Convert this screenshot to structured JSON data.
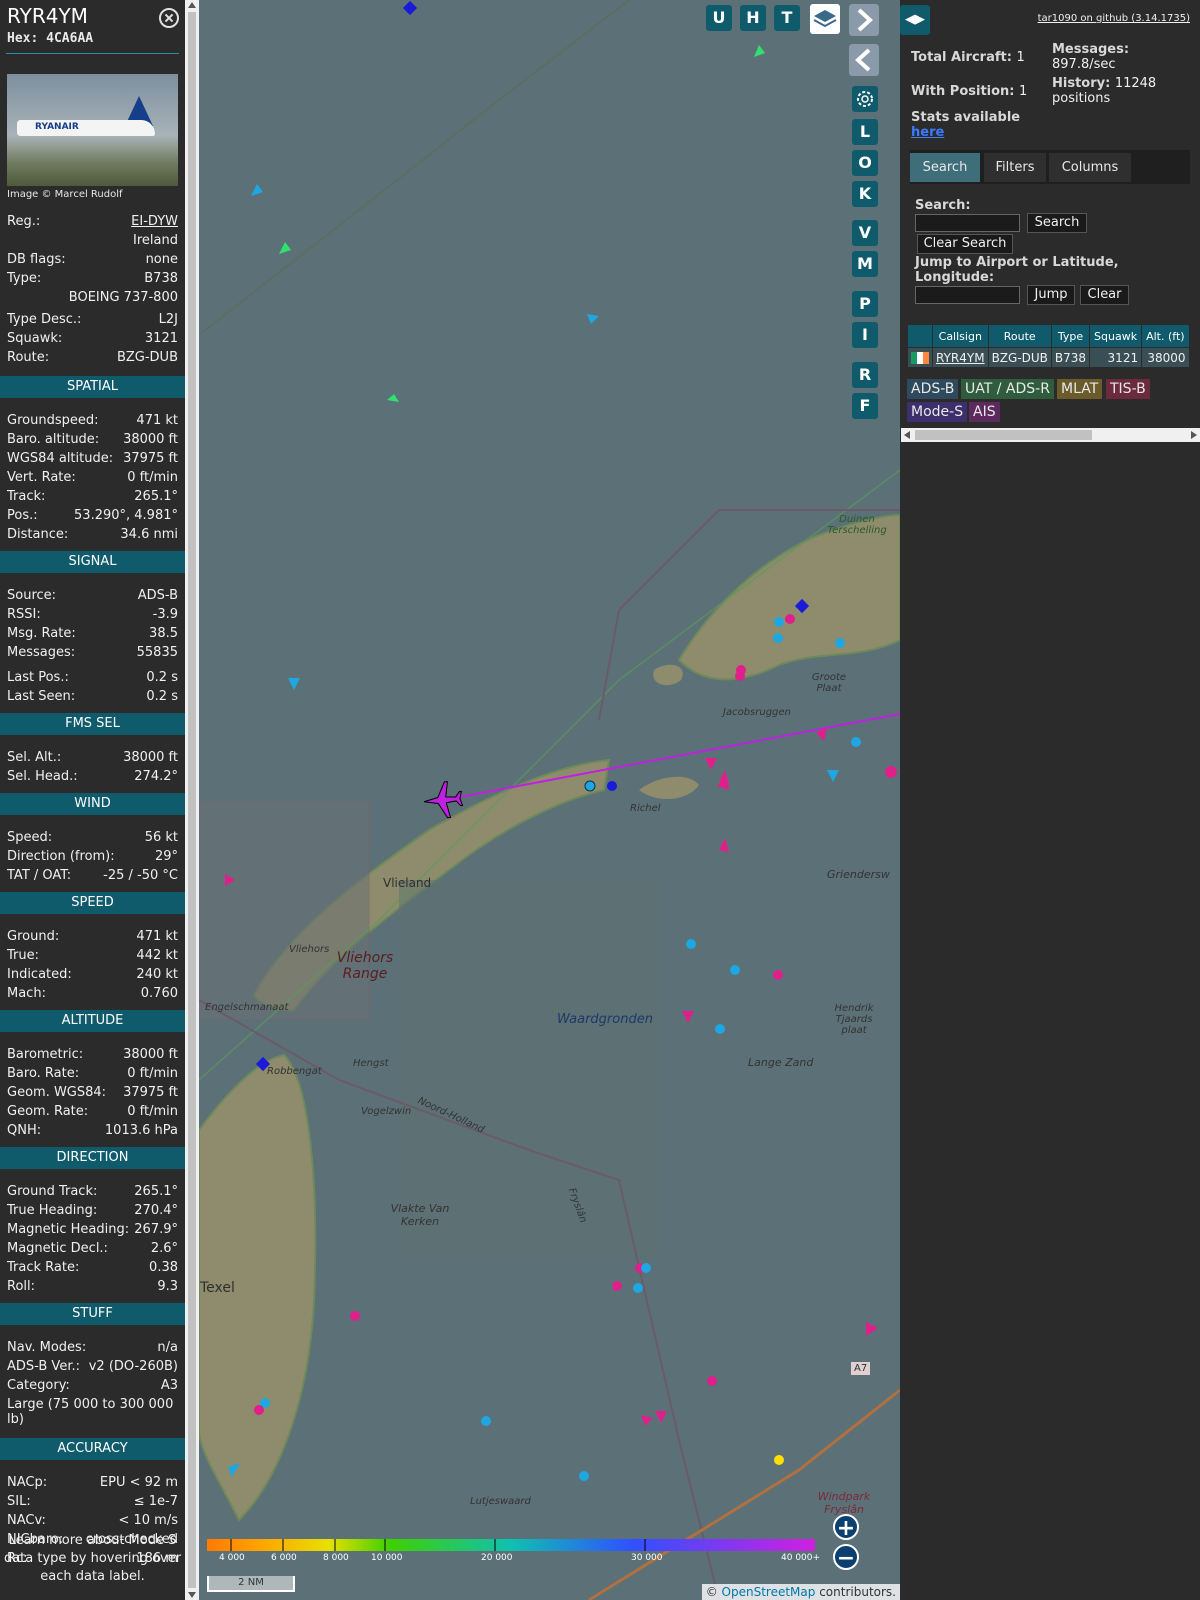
{
  "info": {
    "callsign": "RYR4YM",
    "hex": "Hex: 4CA6AA",
    "photo_credit": "Image © Marcel Rudolf",
    "photo_text": "RYANAIR",
    "top_rows": [
      {
        "k": "Reg.:",
        "v": "EI-DYW",
        "link": true
      },
      {
        "k": "",
        "v": "Ireland"
      },
      {
        "k": "DB flags:",
        "v": "none"
      },
      {
        "k": "Type:",
        "v": "B738"
      },
      {
        "k": "",
        "v": "BOEING 737-800"
      },
      {
        "k": "Type Desc.:",
        "v": "L2J"
      },
      {
        "k": "Squawk:",
        "v": "3121"
      },
      {
        "k": "Route:",
        "v": "BZG-DUB"
      }
    ],
    "sections": [
      {
        "title": "SPATIAL",
        "rows": [
          {
            "k": "Groundspeed:",
            "v": "471 kt"
          },
          {
            "k": "Baro. altitude:",
            "v": "38000 ft"
          },
          {
            "k": "WGS84 altitude:",
            "v": "37975 ft"
          },
          {
            "k": "Vert. Rate:",
            "v": "0 ft/min"
          },
          {
            "k": "Track:",
            "v": "265.1°"
          },
          {
            "k": "Pos.:",
            "v": "53.290°, 4.981°"
          },
          {
            "k": "Distance:",
            "v": "34.6 nmi"
          }
        ]
      },
      {
        "title": "SIGNAL",
        "rows": [
          {
            "k": "Source:",
            "v": "ADS-B"
          },
          {
            "k": "RSSI:",
            "v": "-3.9"
          },
          {
            "k": "Msg. Rate:",
            "v": "38.5"
          },
          {
            "k": "Messages:",
            "v": "55835"
          },
          {
            "k": "Last Pos.:",
            "v": "0.2 s"
          },
          {
            "k": "Last Seen:",
            "v": "0.2 s"
          }
        ]
      },
      {
        "title": "FMS SEL",
        "rows": [
          {
            "k": "Sel. Alt.:",
            "v": "38000 ft"
          },
          {
            "k": "Sel. Head.:",
            "v": "274.2°"
          }
        ]
      },
      {
        "title": "WIND",
        "rows": [
          {
            "k": "Speed:",
            "v": "56 kt"
          },
          {
            "k": "Direction (from):",
            "v": "29°"
          },
          {
            "k": "TAT / OAT:",
            "v": "-25 / -50 °C"
          }
        ]
      },
      {
        "title": "SPEED",
        "rows": [
          {
            "k": "Ground:",
            "v": "471 kt"
          },
          {
            "k": "True:",
            "v": "442 kt"
          },
          {
            "k": "Indicated:",
            "v": "240 kt"
          },
          {
            "k": "Mach:",
            "v": "0.760"
          }
        ]
      },
      {
        "title": "ALTITUDE",
        "rows": [
          {
            "k": "Barometric:",
            "v": "38000 ft"
          },
          {
            "k": "Baro. Rate:",
            "v": "0 ft/min"
          },
          {
            "k": "Geom. WGS84:",
            "v": "37975 ft"
          },
          {
            "k": "Geom. Rate:",
            "v": "0 ft/min"
          },
          {
            "k": "QNH:",
            "v": "1013.6 hPa"
          }
        ]
      },
      {
        "title": "DIRECTION",
        "rows": [
          {
            "k": "Ground Track:",
            "v": "265.1°"
          },
          {
            "k": "True Heading:",
            "v": "270.4°"
          },
          {
            "k": "Magnetic Heading:",
            "v": "267.9°"
          },
          {
            "k": "Magnetic Decl.:",
            "v": "2.6°"
          },
          {
            "k": "Track Rate:",
            "v": "0.38"
          },
          {
            "k": "Roll:",
            "v": "9.3"
          }
        ]
      },
      {
        "title": "STUFF",
        "rows": [
          {
            "k": "Nav. Modes:",
            "v": "n/a"
          },
          {
            "k": "ADS-B Ver.:",
            "v": "v2 (DO-260B)"
          },
          {
            "k": "Category:",
            "v": "A3"
          }
        ]
      },
      {
        "title": "ACCURACY",
        "rows": [
          {
            "k": "NACp:",
            "v": "EPU < 92 m"
          },
          {
            "k": "SIL:",
            "v": "≤ 1e-7"
          },
          {
            "k": "NACv:",
            "v": "< 10 m/s"
          },
          {
            "k": "NICbaro:",
            "v": "cross-checked"
          },
          {
            "k": "Rc:",
            "v": "186 m"
          }
        ]
      }
    ],
    "category_desc": "Large (75 000 to 300 000 lb)",
    "note": "Learn more about Mode S data type by hovering over each data label."
  },
  "map": {
    "buttons": [
      "U",
      "H",
      "T"
    ],
    "side_buttons": [
      "L",
      "O",
      "K",
      "V",
      "M",
      "P",
      "I",
      "R",
      "F"
    ],
    "labels": {
      "vlieland": "Vlieland",
      "vliehors_range": "Vliehors Range",
      "vliehors": "Vliehors",
      "richel": "Richel",
      "waardgronden": "Waardgronden",
      "texel": "Texel",
      "lange_zand": "Lange Zand",
      "lutjeswaard": "Lutjeswaard",
      "vlakte_van_kerken": "Vlakte Van Kerken",
      "noord_holland": "Noord-Holland",
      "fryslan": "Fryslân",
      "windpark": "Windpark Fryslân",
      "duinen": "Duinen Terschelling",
      "groote_plaat": "Groote Plaat",
      "jacobsruggen": "Jacobsruggen",
      "griendersw": "Griendersw",
      "hendrik": "Hendrik Tjaards plaat",
      "engelschmanaat": "Engelschmanaat",
      "hengst": "Hengst",
      "vogelzwin": "Vogelzwin",
      "robbengat": "Robbengat",
      "road": "A7"
    },
    "altitude_scale": [
      "4 000",
      "6 000",
      "8 000",
      "10 000",
      "20 000",
      "30 000",
      "40 000+"
    ],
    "scale": "2 NM",
    "attribution_prefix": "© ",
    "attribution_link": "OpenStreetMap",
    "attribution_suffix": " contributors.",
    "colors": {
      "sea": "#5c7077",
      "land": "#8c8a6a",
      "track": "#c020e0",
      "aircraft": "#c020e0"
    }
  },
  "right": {
    "github": "tar1090 on github (3.14.1735)",
    "total_aircraft_label": "Total Aircraft:",
    "total_aircraft": "1",
    "with_position_label": "With Position:",
    "with_position": "1",
    "messages_label": "Messages:",
    "messages": "897.8/sec",
    "history_label": "History:",
    "history": "11248 positions",
    "stats_label": "Stats available",
    "stats_link": "here",
    "tabs": [
      "Search",
      "Filters",
      "Columns"
    ],
    "search_label": "Search:",
    "search_button": "Search",
    "clear_search_button": "Clear Search",
    "jump_label": "Jump to Airport or Latitude, Longitude:",
    "jump_button": "Jump",
    "clear_button": "Clear",
    "table_headers": [
      "Callsign",
      "Route",
      "Type",
      "Squawk",
      "Alt. (ft)"
    ],
    "table_row": {
      "callsign": "RYR4YM",
      "route": "BZG-DUB",
      "type": "B738",
      "squawk": "3121",
      "alt": "38000"
    },
    "badges": [
      {
        "label": "ADS-B",
        "color": "#2f4a5c"
      },
      {
        "label": "UAT / ADS-R",
        "color": "#2f5c3d"
      },
      {
        "label": "MLAT",
        "color": "#6b5a2a"
      },
      {
        "label": "TIS-B",
        "color": "#6b2a3d"
      },
      {
        "label": "Mode-S",
        "color": "#3d2f6b"
      },
      {
        "label": "AIS",
        "color": "#5c2a5c"
      }
    ]
  }
}
